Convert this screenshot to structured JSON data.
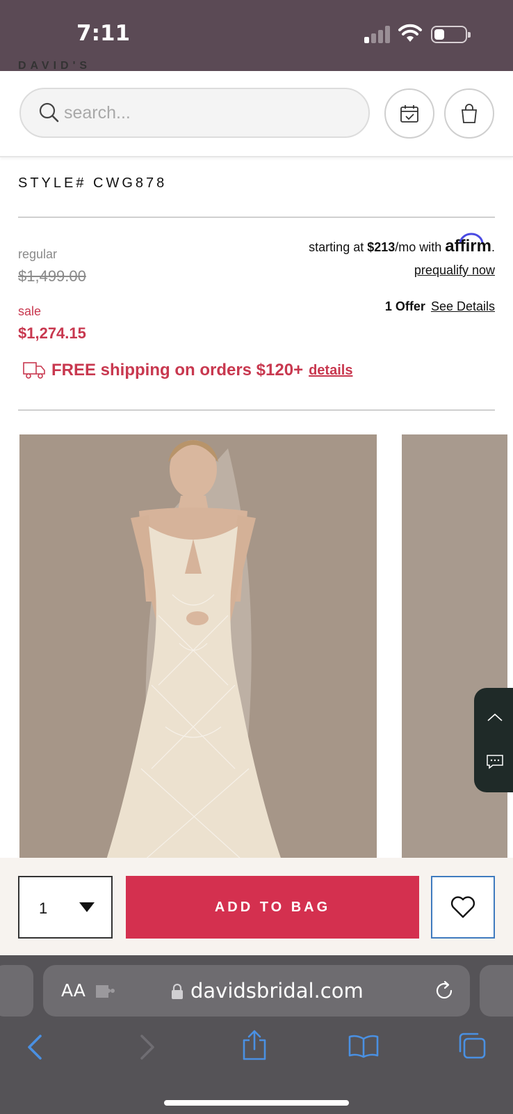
{
  "status_bar": {
    "time": "7:11"
  },
  "header": {
    "logo_text": "DAVID'S BRIDAL",
    "search": {
      "placeholder": "search..."
    },
    "icons": [
      "search-icon",
      "calendar-check-icon",
      "shopping-bag-icon"
    ]
  },
  "product": {
    "style_number": "STYLE# CWG878",
    "regular_label": "regular",
    "regular_price": "$1,499.00",
    "sale_label": "sale",
    "sale_price": "$1,274.15",
    "financing": {
      "prefix": "starting at ",
      "amount": "$213",
      "suffix": "/mo with ",
      "brand": "affirm",
      "period": ".",
      "prequalify_link": "prequalify now"
    },
    "offer": {
      "count": "1 Offer",
      "link": "See Details"
    },
    "shipping": {
      "text": "FREE shipping on orders $120+",
      "link": "details"
    }
  },
  "action_bar": {
    "quantity": "1",
    "add_to_bag": "ADD TO BAG"
  },
  "browser": {
    "aa_label": "AA",
    "url": "davidsbridal.com"
  },
  "colors": {
    "sale": "#c8384f",
    "add_button": "#d4304f",
    "wishlist_border": "#3f7bbf",
    "safari_icons": "#4a90e2"
  }
}
